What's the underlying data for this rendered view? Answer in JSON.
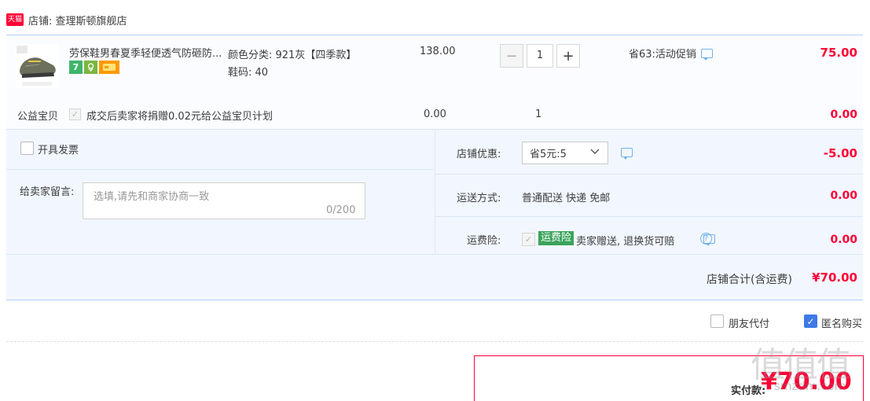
{
  "shop": {
    "badge": "天猫",
    "label": "店铺: 查理斯顿旗舰店"
  },
  "item": {
    "title": "劳保鞋男春夏季轻便透气防砸防...",
    "sku_color": "颜色分类: 921灰【四季款】",
    "sku_size": "鞋码: 40",
    "unit_price": "138.00",
    "quantity": "1",
    "qty_minus": "−",
    "qty_plus": "+",
    "promo": "省63:活动促销",
    "total": "75.00",
    "svc_7": "7"
  },
  "charity": {
    "label": "公益宝贝",
    "text": "成交后卖家将捐赠0.02元给公益宝贝计划",
    "price": "0.00",
    "qty": "1",
    "total": "0.00"
  },
  "invoice": {
    "label": "开具发票"
  },
  "message": {
    "label": "给卖家留言:",
    "placeholder": "选填,请先和商家协商一致",
    "count": "0/200"
  },
  "discount": {
    "label": "店铺优惠:",
    "selected": "省5元:5",
    "total": "-5.00"
  },
  "shipping": {
    "label": "运送方式:",
    "value": "普通配送 快递 免邮",
    "total": "0.00"
  },
  "insurance": {
    "label": "运费险:",
    "badge": "运费险",
    "text": "卖家赠送, 退换货可赔",
    "help": "?",
    "total": "0.00"
  },
  "subtotal": {
    "label": "店铺合计(含运费)",
    "value": "¥70.00"
  },
  "options": {
    "friend_pay": "朋友代付",
    "anonymous": "匿名购买"
  },
  "payment": {
    "label": "实付款:",
    "value": "¥70.00"
  },
  "watermark": {
    "text": "值值值",
    "url": "smzdm.com"
  },
  "colors": {
    "accent": "#ff0036",
    "blue_border": "#b2d1ff",
    "check_blue": "#3d7ae8"
  }
}
